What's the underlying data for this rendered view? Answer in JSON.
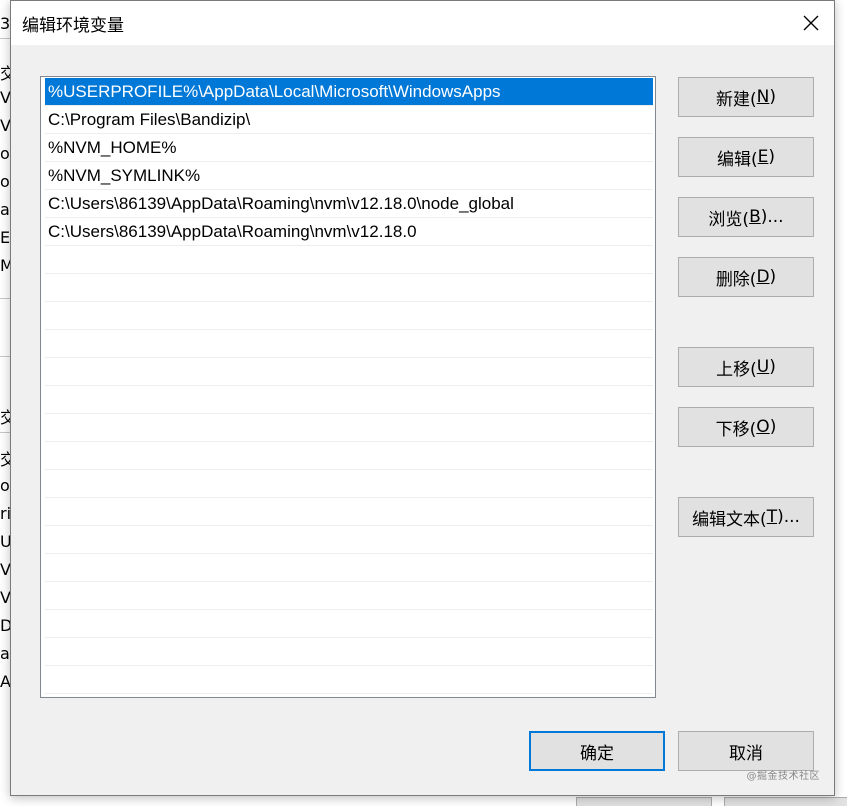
{
  "background": {
    "fragments": [
      "3",
      "交量",
      "V",
      "V",
      "on",
      "on",
      "at",
      "E",
      "M",
      "交",
      "交量",
      "o",
      "ri",
      "U",
      "V",
      "V",
      "DS",
      "at",
      "A"
    ]
  },
  "dialog": {
    "title": "编辑环境变量",
    "close_glyph": "✕",
    "entries": [
      "%USERPROFILE%\\AppData\\Local\\Microsoft\\WindowsApps",
      "C:\\Program Files\\Bandizip\\",
      "%NVM_HOME%",
      "%NVM_SYMLINK%",
      "C:\\Users\\86139\\AppData\\Roaming\\nvm\\v12.18.0\\node_global",
      "C:\\Users\\86139\\AppData\\Roaming\\nvm\\v12.18.0"
    ],
    "selected_index": 0,
    "buttons": {
      "new": {
        "label": "新建(",
        "key": "N",
        "suffix": ")"
      },
      "edit": {
        "label": "编辑(",
        "key": "E",
        "suffix": ")"
      },
      "browse": {
        "label": "浏览(",
        "key": "B",
        "suffix": ")..."
      },
      "delete": {
        "label": "删除(",
        "key": "D",
        "suffix": ")"
      },
      "move_up": {
        "label": "上移(",
        "key": "U",
        "suffix": ")"
      },
      "move_down": {
        "label": "下移(",
        "key": "O",
        "suffix": ")"
      },
      "edit_text": {
        "label": "编辑文本(",
        "key": "T",
        "suffix": ")..."
      },
      "ok": "确定",
      "cancel": "取消"
    },
    "watermark": "@掘金技术社区"
  },
  "colors": {
    "selection": "#0078d7",
    "dialog_bg": "#f0f0f0",
    "button_bg": "#e1e1e1"
  }
}
